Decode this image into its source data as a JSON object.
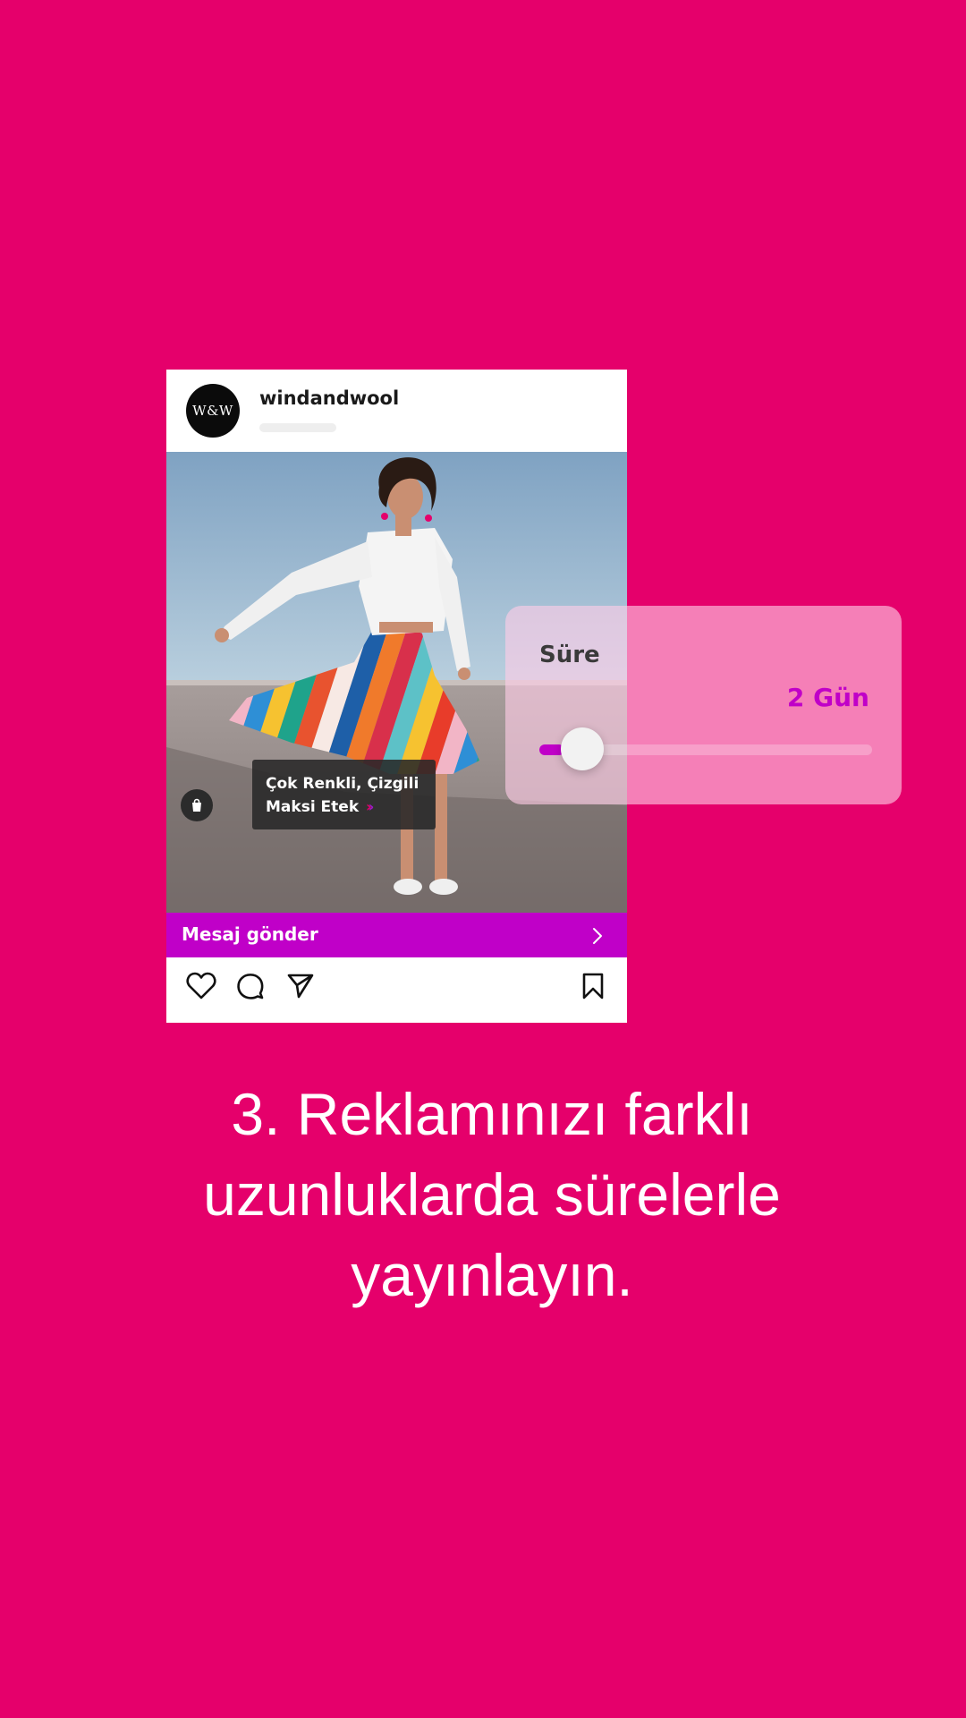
{
  "post": {
    "avatar_text": "W&W",
    "username": "windandwool",
    "product_tag": {
      "line1": "Çok Renkli, Çizgili",
      "line2": "Maksi Etek"
    },
    "cta_label": "Mesaj gönder",
    "icons": {
      "shop": "shopping-bag-icon",
      "like": "heart-icon",
      "comment": "comment-icon",
      "share": "send-icon",
      "save": "bookmark-icon",
      "cta": "chevron-right-icon",
      "tag": "double-chevron-icon"
    }
  },
  "duration": {
    "label": "Süre",
    "value_text": "2 Gün",
    "slider_level_percent": 6
  },
  "caption": {
    "line1": "3. Reklamınızı farklı",
    "line2": "uzunluklarda sürelerle",
    "line3": "yayınlayın."
  },
  "colors": {
    "background": "#E5006B",
    "accent_purple": "#C000C8",
    "card": "#FFFFFF"
  }
}
